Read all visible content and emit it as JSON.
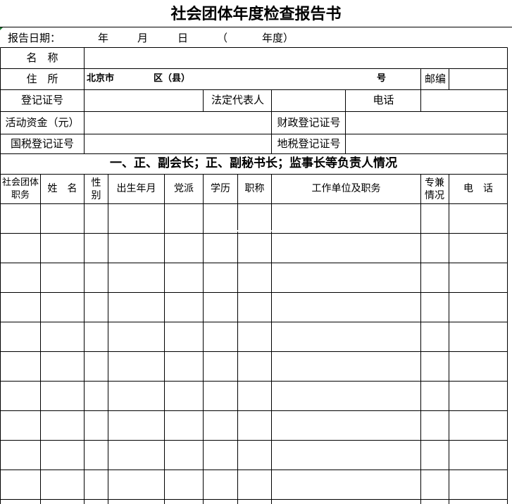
{
  "title": "社会团体年度检查报告书",
  "report_line": {
    "label": "报告日期：",
    "year": "年",
    "month": "月",
    "day": "日",
    "paren_open": "（",
    "annual": "年度）"
  },
  "basic": {
    "name_label": "名　称",
    "address_label": "住　所",
    "city": "北京市",
    "district": "区（县）",
    "number": "号",
    "postcode_label": "邮编",
    "reg_no_label": "登记证号",
    "legal_rep_label": "法定代表人",
    "phone_label": "电话",
    "funds_label": "活动资金（元）",
    "finance_reg_label": "财政登记证号",
    "national_tax_label": "国税登记证号",
    "local_tax_label": "地税登记证号"
  },
  "section1": {
    "title": "一、正、副会长；正、副秘书长；监事长等负责人情况",
    "headers": [
      "社会团体职务",
      "姓　名",
      "性别",
      "出生年月",
      "党派",
      "学历",
      "职称",
      "工作单位及职务",
      "专兼情况",
      "电　话"
    ],
    "empty_rows": 10
  }
}
